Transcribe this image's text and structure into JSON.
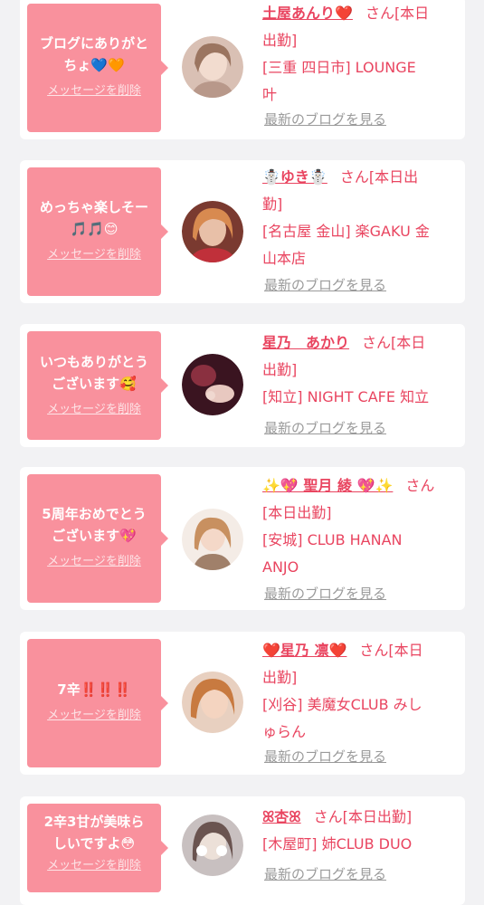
{
  "delete_label": "メッセージを削除",
  "blog_link_label": "最新のブログを見る",
  "items": [
    {
      "message_lines": [
        "ブログにありがと",
        "ちょ💙🧡"
      ],
      "name": "土屋あんり❤️",
      "suffix": "さん[本日",
      "detail_lines": [
        "出勤]",
        "[三重 四日市] LOUNGE",
        "叶"
      ],
      "avatar_color": "#c8a898"
    },
    {
      "message_lines": [
        "めっちゃ楽しそー",
        "🎵🎵😊"
      ],
      "name": "☃️ゆき☃️",
      "suffix": "さん[本日出",
      "detail_lines": [
        "勤]",
        "[名古屋 金山] 楽GAKU 金",
        "山本店"
      ],
      "avatar_color": "#b05848"
    },
    {
      "message_lines": [
        "いつもありがとう",
        "ございます🥰"
      ],
      "name": "星乃　あかり",
      "suffix": "さん[本日",
      "detail_lines": [
        "出勤]",
        "[知立] NIGHT CAFE 知立"
      ],
      "avatar_color": "#5a2030"
    },
    {
      "message_lines": [
        "5周年おめでとう",
        "ございます💖"
      ],
      "name": "✨💖 聖月 綾 💖✨",
      "suffix": "さん",
      "detail_lines": [
        "[本日出勤]",
        "[安城] CLUB HANAN",
        "ANJO"
      ],
      "avatar_color": "#d8b088"
    },
    {
      "message_lines": [
        "7辛‼️‼️‼️"
      ],
      "name": "❤️星乃 凛❤️",
      "suffix": "さん[本日",
      "detail_lines": [
        "出勤]",
        "[刈谷] 美魔女CLUB みし",
        "ゅらん"
      ],
      "avatar_color": "#c89070"
    },
    {
      "message_lines": [
        "2辛3甘が美味ら",
        "しいですよ😳"
      ],
      "name": "ꕤ杏ꕤ",
      "suffix": "さん[本日出勤]",
      "detail_lines": [
        "[木屋町] 姉CLUB DUO"
      ],
      "avatar_color": "#a0a0a8"
    }
  ]
}
